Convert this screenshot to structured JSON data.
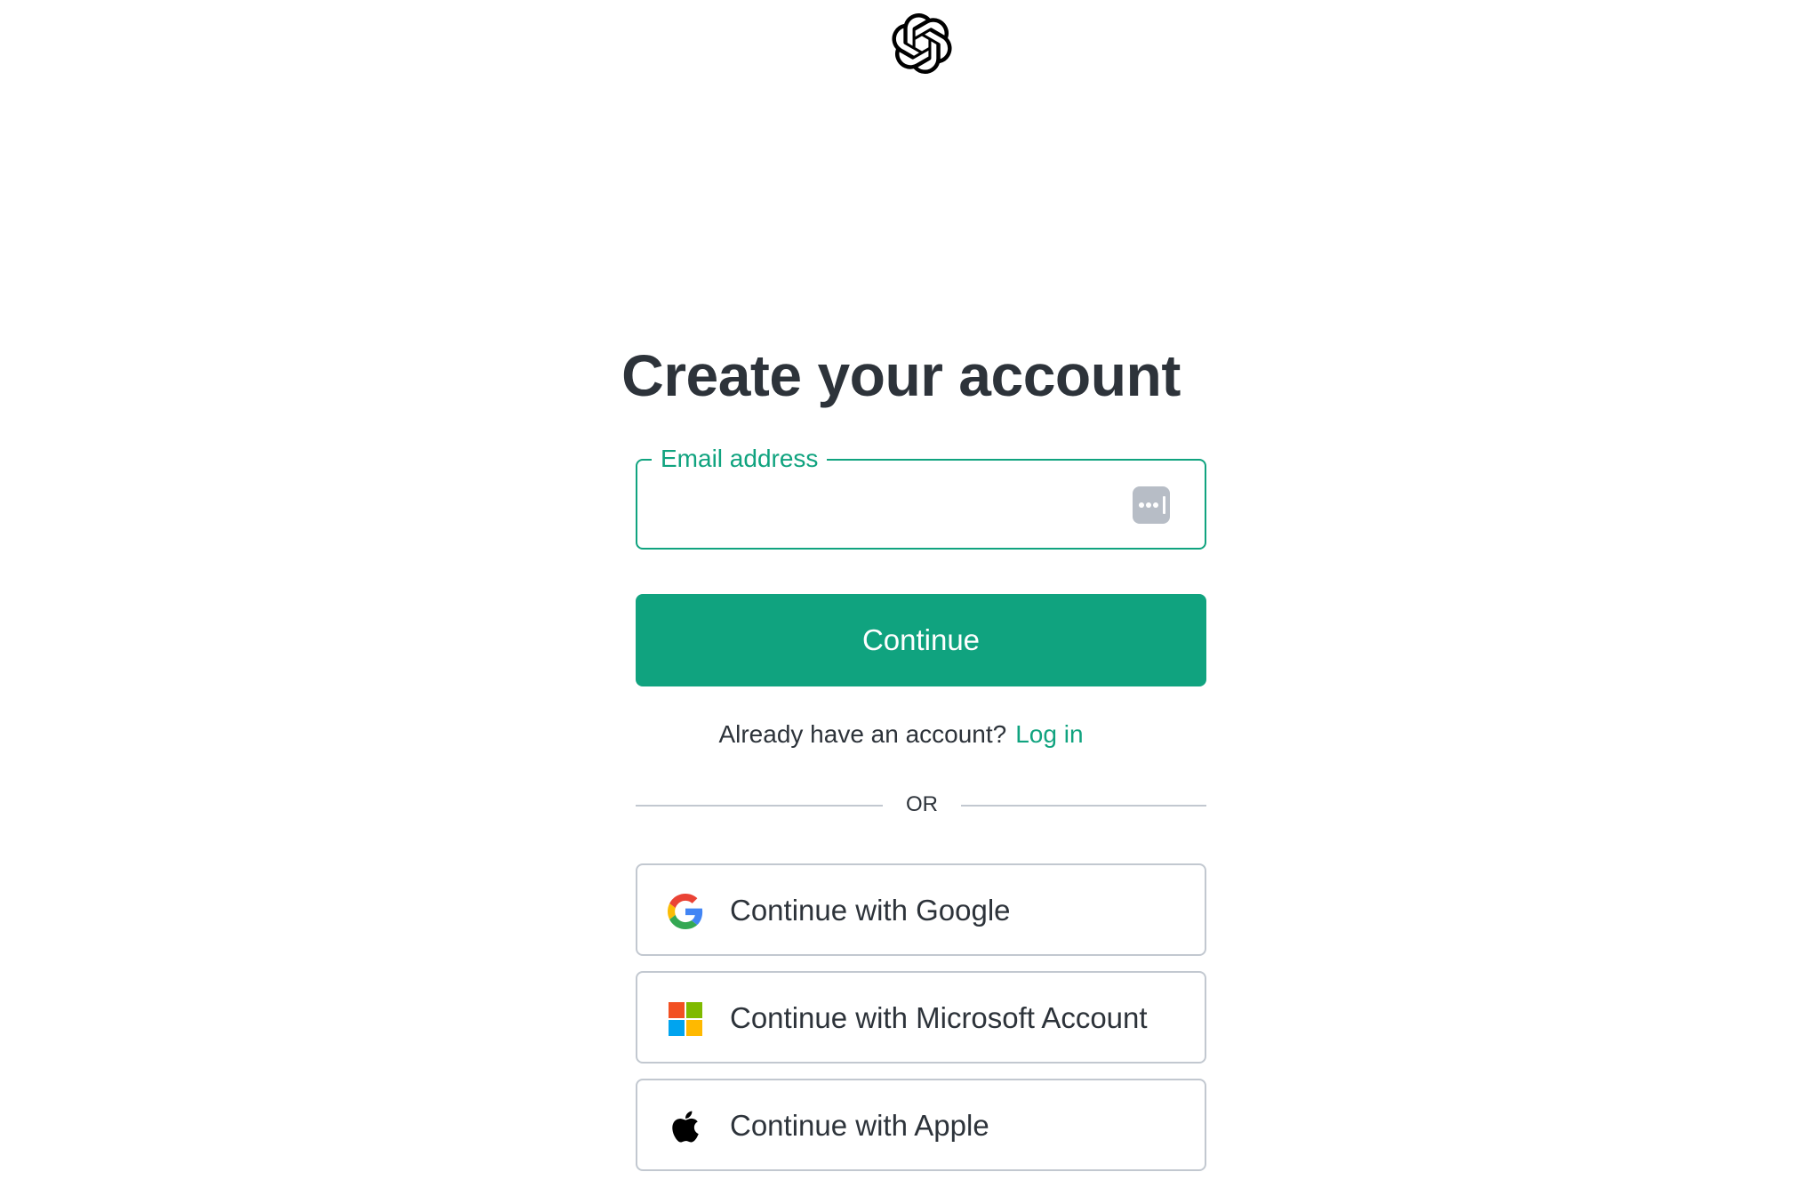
{
  "logo": {
    "icon": "openai-logo-icon"
  },
  "page": {
    "title": "Create your account"
  },
  "email": {
    "label": "Email address",
    "value": "",
    "placeholder": ""
  },
  "continue_button": {
    "label": "Continue"
  },
  "login_prompt": {
    "text": "Already have an account?",
    "link": "Log in"
  },
  "divider": {
    "text": "OR"
  },
  "social": [
    {
      "label": "Continue with Google",
      "icon": "google-icon"
    },
    {
      "label": "Continue with Microsoft Account",
      "icon": "microsoft-icon"
    },
    {
      "label": "Continue with Apple",
      "icon": "apple-icon"
    }
  ],
  "colors": {
    "accent": "#10a37f",
    "text": "#2d333a",
    "border": "#c2c8d0",
    "google_blue": "#4285F4",
    "google_red": "#EA4335",
    "google_yellow": "#FBBC05",
    "google_green": "#34A853",
    "ms_red": "#F25022",
    "ms_green": "#7FBA00",
    "ms_blue": "#00A4EF",
    "ms_yellow": "#FFB900"
  }
}
